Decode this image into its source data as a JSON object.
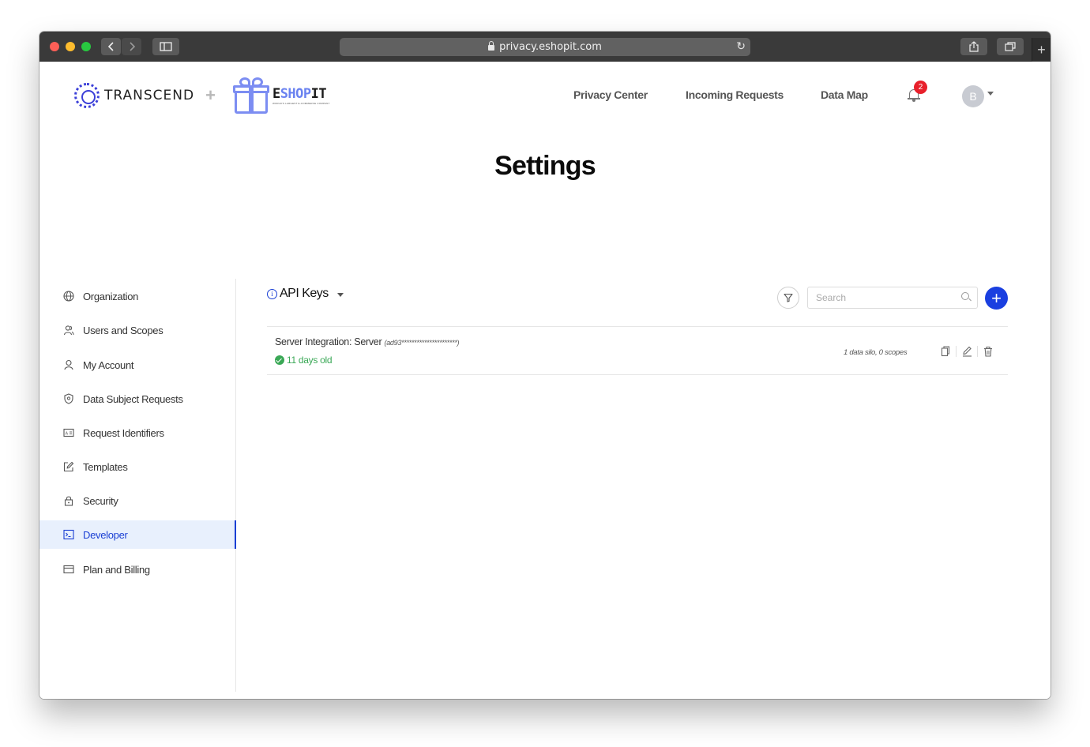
{
  "browser": {
    "url": "privacy.eshopit.com"
  },
  "brand": {
    "transcend": "TRANSCEND",
    "plus": "+",
    "eshop_prefix": "E",
    "eshop_mid": "SHOP",
    "eshop_suffix": "IT",
    "eshop_tagline": "WORLD'S LARGEST E-COMMERCE COMPANY"
  },
  "nav": {
    "privacy_center": "Privacy Center",
    "incoming_requests": "Incoming Requests",
    "data_map": "Data Map",
    "notification_count": "2",
    "avatar_initial": "B"
  },
  "page": {
    "title": "Settings"
  },
  "sidebar": {
    "items": [
      {
        "label": "Organization",
        "icon": "globe-icon"
      },
      {
        "label": "Users and Scopes",
        "icon": "users-icon"
      },
      {
        "label": "My Account",
        "icon": "user-icon"
      },
      {
        "label": "Data Subject Requests",
        "icon": "shield-icon"
      },
      {
        "label": "Request Identifiers",
        "icon": "id-card-icon"
      },
      {
        "label": "Templates",
        "icon": "edit-icon"
      },
      {
        "label": "Security",
        "icon": "lock-icon"
      },
      {
        "label": "Developer",
        "icon": "terminal-icon",
        "active": true
      },
      {
        "label": "Plan and Billing",
        "icon": "credit-card-icon"
      }
    ]
  },
  "main": {
    "section_title": "API Keys",
    "search_placeholder": "Search",
    "add_label": "+",
    "api_keys": [
      {
        "name": "Server Integration: Server",
        "masked_key": "(ad93**********************)",
        "age": "11 days old",
        "meta": "1 data silo, 0 scopes"
      }
    ]
  },
  "colors": {
    "accent": "#1a3fe0",
    "active_bg": "#e8f0fd",
    "success": "#3aa856",
    "badge": "#e8202b",
    "brand_blue": "#3b3fd8",
    "eshop_blue": "#6a82f0"
  }
}
